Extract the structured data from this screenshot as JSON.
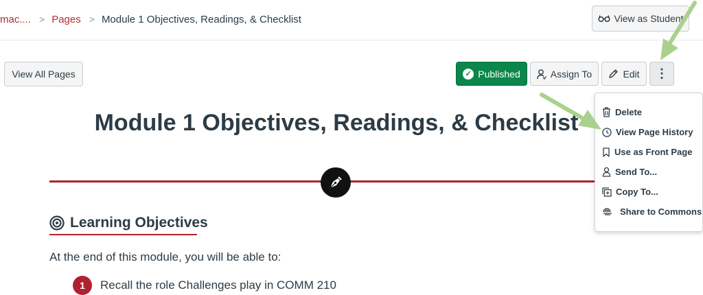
{
  "breadcrumb": {
    "course": "mac....",
    "pages": "Pages",
    "current": "Module 1 Objectives, Readings, & Checklist",
    "separator": ">"
  },
  "header": {
    "view_as_student": "View as Student"
  },
  "toolbar": {
    "view_all_pages": "View All Pages",
    "published": "Published",
    "assign_to": "Assign To",
    "edit": "Edit",
    "more": "⋮"
  },
  "menu": {
    "items": [
      {
        "label": "Delete",
        "icon": "trash-icon"
      },
      {
        "label": "View Page History",
        "icon": "clock-icon"
      },
      {
        "label": "Use as Front Page",
        "icon": "bookmark-icon"
      },
      {
        "label": "Send To...",
        "icon": "user-send-icon"
      },
      {
        "label": "Copy To...",
        "icon": "copy-icon"
      },
      {
        "label": "Share to Commons",
        "icon": "commons-icon"
      }
    ]
  },
  "content": {
    "title": "Module 1 Objectives, Readings, & Checklist",
    "section_heading": "Learning Objectives",
    "intro": "At the end of this module, you will be able to:",
    "list": [
      {
        "number": "1",
        "text": "Recall the role Challenges play in COMM 210"
      }
    ]
  },
  "colors": {
    "brand_red": "#b0202f",
    "published_green": "#0b874b",
    "annotation_arrow": "#a9d18e"
  }
}
